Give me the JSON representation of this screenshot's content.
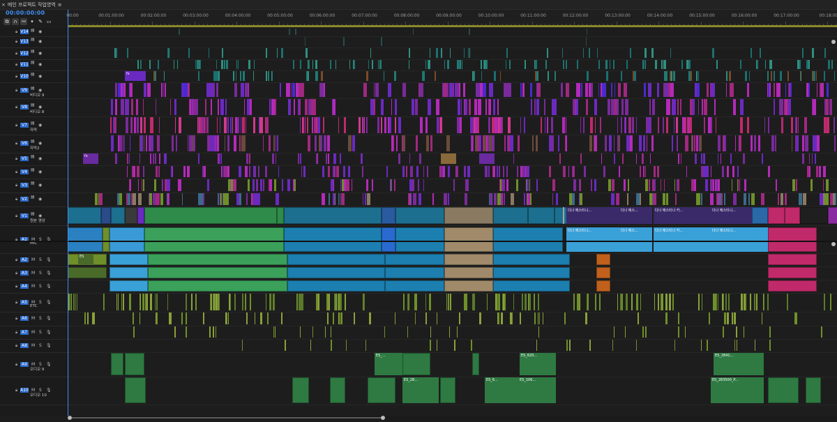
{
  "panel": {
    "close_glyph": "×",
    "tab_title": "메인 프로젝트 작업영역",
    "menu_glyph": "≡",
    "timecode": "00:00:00:00"
  },
  "ruler": {
    "labels": [
      "00:00",
      "00:01:00:00",
      "00:02:00:00",
      "00:03:00:00",
      "00:04:00:00",
      "00:05:00:00",
      "00:06:00:00",
      "00:07:00:00",
      "00:08:00:00",
      "00:09:00:00",
      "00:10:00:00",
      "00:11:00:00",
      "00:12:00:00",
      "00:13:00:00",
      "00:14:00:00",
      "00:15:00:00",
      "00:16:00:00",
      "00:17:00:00",
      "00:18:00"
    ]
  },
  "video_tracks": [
    {
      "id": "V14",
      "name": ""
    },
    {
      "id": "V13",
      "name": ""
    },
    {
      "id": "V12",
      "name": ""
    },
    {
      "id": "V11",
      "name": ""
    },
    {
      "id": "V10",
      "name": ""
    },
    {
      "id": "V9",
      "name": "비디오 9"
    },
    {
      "id": "V8",
      "name": "비디오 8"
    },
    {
      "id": "V7",
      "name": "자막"
    },
    {
      "id": "V6",
      "name": "자막2"
    },
    {
      "id": "V5",
      "name": ""
    },
    {
      "id": "V4",
      "name": ""
    },
    {
      "id": "V3",
      "name": ""
    },
    {
      "id": "V2",
      "name": ""
    },
    {
      "id": "V1",
      "name": "원본 영상"
    }
  ],
  "audio_tracks": [
    {
      "id": "A1",
      "name": "MIC"
    },
    {
      "id": "A2",
      "name": ""
    },
    {
      "id": "A3",
      "name": ""
    },
    {
      "id": "A4",
      "name": ""
    },
    {
      "id": "A5",
      "name": "ETC"
    },
    {
      "id": "A6",
      "name": ""
    },
    {
      "id": "A7",
      "name": ""
    },
    {
      "id": "A8",
      "name": ""
    },
    {
      "id": "A9",
      "name": "오디오 9"
    },
    {
      "id": "A10",
      "name": "오디오 10"
    }
  ],
  "header_icons": {
    "lock": "lock-icon",
    "eye": "eye-icon",
    "film": "film-icon",
    "mute": "M",
    "solo": "S",
    "mic": "mic-icon"
  },
  "clip_labels": {
    "v1_named": [
      "다나 에스티니...",
      "다나 에스...",
      "다나 에스티나 카...",
      "다나 에스티니..."
    ],
    "a1_named": [
      "다나 에스티니...",
      "다나 에스...",
      "다나 에스티나 카...",
      "다나 에스티니..."
    ],
    "a2_first": "ES",
    "a9": [
      "ES_...",
      "ES_620...",
      "ES_2841..."
    ],
    "a10": [
      "ES_28...",
      "ES_6...",
      "ES_106...",
      "ES_283500_P..."
    ],
    "fx": "fx"
  },
  "colors": {
    "accent": "#3f8ef0",
    "green": "#2e8b4a",
    "teal": "#1c6f8f",
    "tan": "#8a7a62",
    "orange": "#c0601c",
    "pink": "#c02a6a",
    "purple": "#6a2ac0",
    "magenta": "#b32ab8",
    "olive": "#6f8f2a",
    "audio_green": "#2e8b4a"
  }
}
